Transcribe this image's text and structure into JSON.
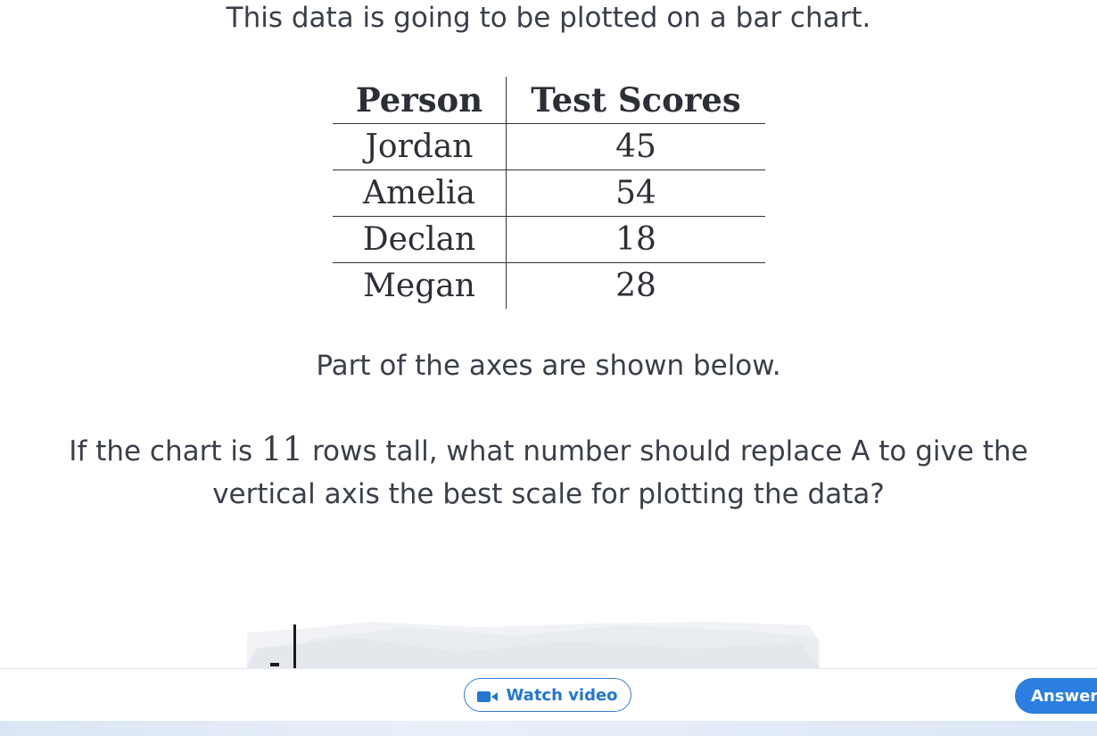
{
  "intro_text": "This data is going to be plotted on a bar chart.",
  "table": {
    "headers": [
      "Person",
      "Test Scores"
    ],
    "rows": [
      [
        "Jordan",
        "45"
      ],
      [
        "Amelia",
        "54"
      ],
      [
        "Declan",
        "18"
      ],
      [
        "Megan",
        "28"
      ]
    ]
  },
  "axes_text": "Part of the axes are shown below.",
  "question": {
    "before": "If the chart is ",
    "number": "11",
    "after": " rows tall, what number should replace A to give the vertical axis the best scale for plotting the data?"
  },
  "footer": {
    "watch_video_label": "Watch video",
    "watch_video_icon": "video-camera-icon",
    "answer_label": "Answer"
  },
  "colors": {
    "accent": "#2a7fe0",
    "text": "#3a3f4a"
  }
}
